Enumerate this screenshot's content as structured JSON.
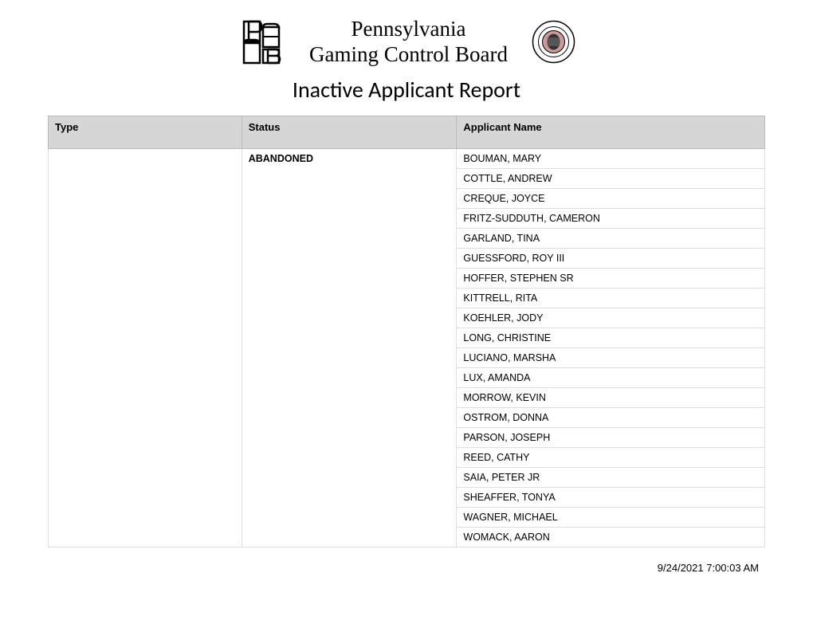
{
  "header": {
    "org_line1": "Pennsylvania",
    "org_line2": "Gaming Control Board"
  },
  "title": "Inactive Applicant Report",
  "columns": {
    "type": "Type",
    "status": "Status",
    "name": "Applicant Name"
  },
  "type_value": "",
  "status_value": "ABANDONED",
  "applicants": [
    "BOUMAN, MARY",
    "COTTLE, ANDREW",
    "CREQUE, JOYCE",
    "FRITZ-SUDDUTH, CAMERON",
    "GARLAND, TINA",
    "GUESSFORD, ROY III",
    "HOFFER, STEPHEN SR",
    "KITTRELL, RITA",
    "KOEHLER, JODY",
    "LONG, CHRISTINE",
    "LUCIANO, MARSHA",
    "LUX, AMANDA",
    "MORROW, KEVIN",
    "OSTROM, DONNA",
    "PARSON, JOSEPH",
    "REED, CATHY",
    "SAIA, PETER JR",
    "SHEAFFER, TONYA",
    "WAGNER, MICHAEL",
    "WOMACK, AARON"
  ],
  "footer": {
    "timestamp": "9/24/2021 7:00:03 AM"
  }
}
